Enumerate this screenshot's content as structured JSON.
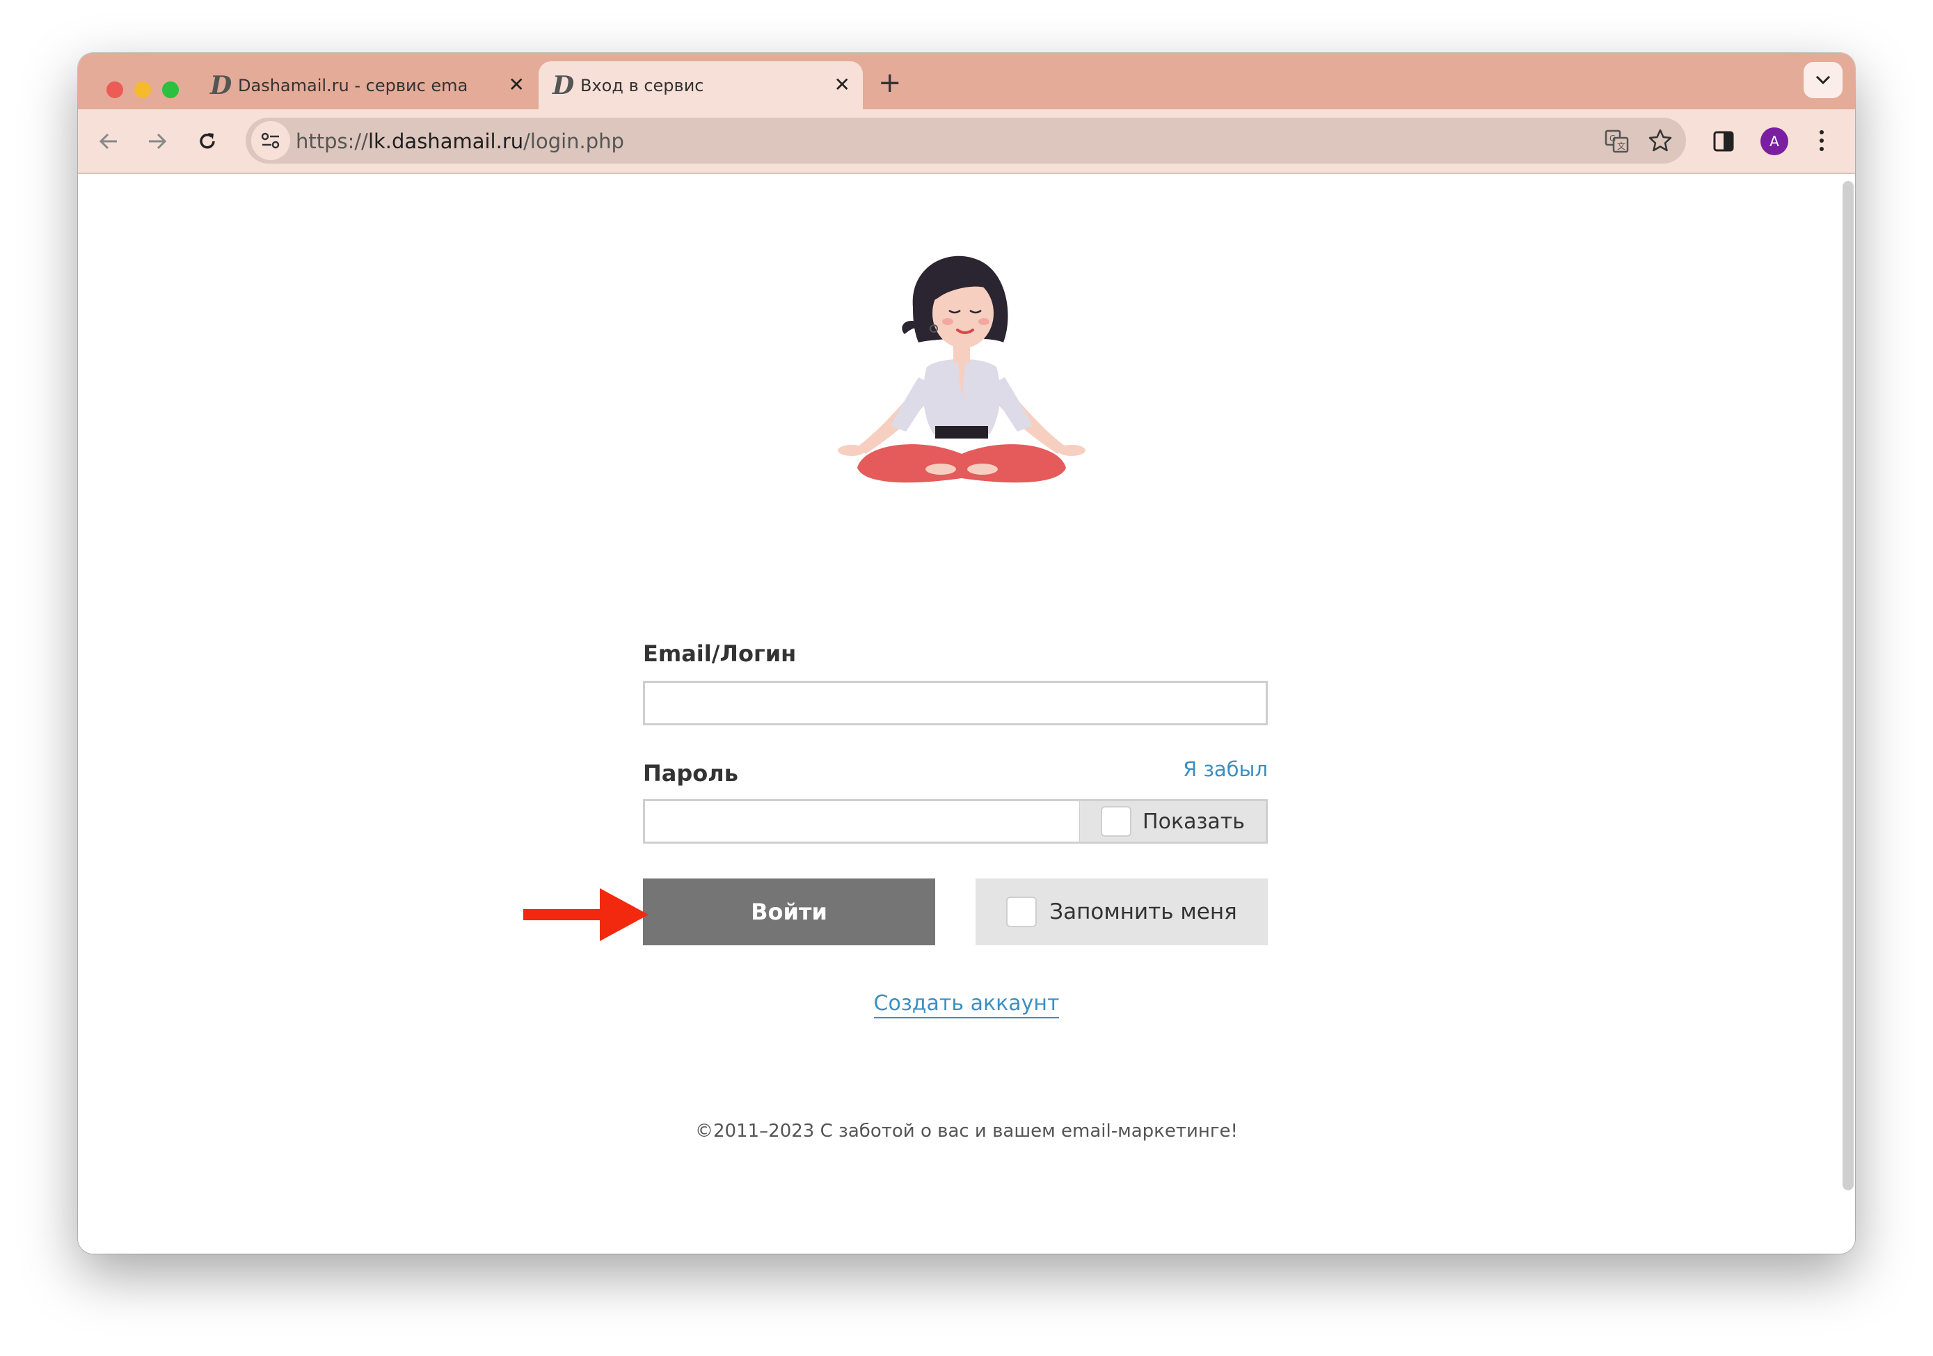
{
  "browser": {
    "tabs": [
      {
        "title": "Dashamail.ru - сервис email-",
        "favicon": "dashamail-d-icon",
        "active": false
      },
      {
        "title": "Вход в сервис",
        "favicon": "dashamail-d-icon",
        "active": true
      }
    ],
    "new_tab": "+",
    "url_prefix": "https://",
    "url_host": "lk.dashamail.ru",
    "url_path": "/login.php",
    "profile_initial": "A",
    "profile_color": "#7b1fa2"
  },
  "login": {
    "email_label": "Email/Логин",
    "email_value": "",
    "password_label": "Пароль",
    "password_value": "",
    "forgot_link": "Я забыл",
    "show_password": "Показать",
    "submit": "Войти",
    "remember": "Запомнить меня",
    "create_account": "Создать аккаунт"
  },
  "footer": {
    "text": "©2011–2023 С заботой о вас и вашем email-маркетинге!"
  },
  "colors": {
    "tabstrip": "#e4ab98",
    "toolbar": "#f6e0d7",
    "link": "#3c8fc1",
    "submit_bg": "#757575",
    "annotation_arrow": "#f2280f"
  }
}
